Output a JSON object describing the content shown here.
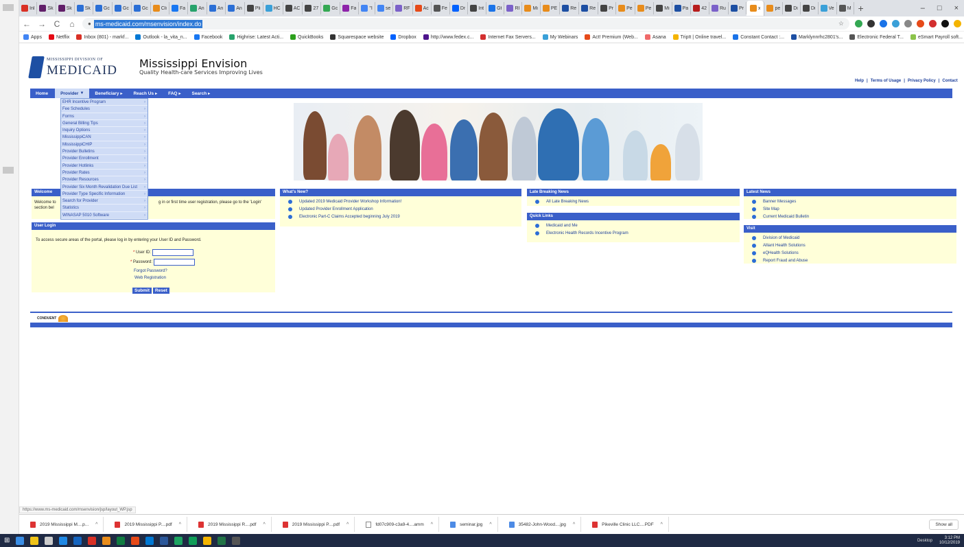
{
  "tabs": [
    {
      "label": "Inl",
      "color": "#d93025"
    },
    {
      "label": "Sk",
      "color": "#611f69"
    },
    {
      "label": "Sk",
      "color": "#611f69"
    },
    {
      "label": "Sk",
      "color": "#2b6fd6"
    },
    {
      "label": "Gc",
      "color": "#2b6fd6"
    },
    {
      "label": "Gc",
      "color": "#2b6fd6"
    },
    {
      "label": "Gc",
      "color": "#2b6fd6"
    },
    {
      "label": "Cli",
      "color": "#e88c1b"
    },
    {
      "label": "Fa",
      "color": "#1877f2"
    },
    {
      "label": "An",
      "color": "#27a36c"
    },
    {
      "label": "An",
      "color": "#2b6fd6"
    },
    {
      "label": "An",
      "color": "#2b6fd6"
    },
    {
      "label": "Pli",
      "color": "#444444"
    },
    {
      "label": "HC",
      "color": "#3aa0d8"
    },
    {
      "label": "AC",
      "color": "#444444"
    },
    {
      "label": "27",
      "color": "#444444"
    },
    {
      "label": "Gc",
      "color": "#34a853"
    },
    {
      "label": "Fa",
      "color": "#8e24aa"
    },
    {
      "label": "\"I",
      "color": "#4285f4"
    },
    {
      "label": "se",
      "color": "#4285f4"
    },
    {
      "label": "RF",
      "color": "#7b61c9"
    },
    {
      "label": "Ac",
      "color": "#e64a19"
    },
    {
      "label": "Fe",
      "color": "#555555"
    },
    {
      "label": "Dr",
      "color": "#0061fe"
    },
    {
      "label": "Int",
      "color": "#444444"
    },
    {
      "label": "Gt",
      "color": "#1a73e8"
    },
    {
      "label": "RI",
      "color": "#7b61c9"
    },
    {
      "label": "Mi",
      "color": "#e88c1b"
    },
    {
      "label": "PE",
      "color": "#e88c1b"
    },
    {
      "label": "Re",
      "color": "#1d4fa3"
    },
    {
      "label": "Re",
      "color": "#1d4fa3"
    },
    {
      "label": "Pr",
      "color": "#444444"
    },
    {
      "label": "Pe",
      "color": "#e88c1b"
    },
    {
      "label": "Pe",
      "color": "#e88c1b"
    },
    {
      "label": "Mi",
      "color": "#444444"
    },
    {
      "label": "Pa",
      "color": "#1d4fa3"
    },
    {
      "label": "42",
      "color": "#b71c1c"
    },
    {
      "label": "Ru",
      "color": "#7b61c9"
    },
    {
      "label": "Pr",
      "color": "#1d4fa3"
    }
  ],
  "active_tab": {
    "label": "x",
    "color": "#e88c1b"
  },
  "tabs_after": [
    {
      "label": "pe",
      "color": "#e88c1b"
    },
    {
      "label": "Di",
      "color": "#444444"
    },
    {
      "label": "Di",
      "color": "#444444"
    },
    {
      "label": "Ve",
      "color": "#3aa0d8"
    },
    {
      "label": "M",
      "color": "#555555"
    }
  ],
  "window_controls": {
    "min": "–",
    "max": "□",
    "close": "×"
  },
  "toolbar": {
    "back": "←",
    "forward": "→",
    "reload": "C",
    "home": "⌂",
    "url": "ms-medicaid.com/msenvision/index.do"
  },
  "bookmarks": [
    {
      "label": "Apps",
      "color": "#4285f4"
    },
    {
      "label": "Netflix",
      "color": "#e50914"
    },
    {
      "label": "Inbox (801) - markf...",
      "color": "#d93025"
    },
    {
      "label": "Outlook - la_vita_n...",
      "color": "#0078d4"
    },
    {
      "label": "Facebook",
      "color": "#1877f2"
    },
    {
      "label": "Highrise: Latest Acti...",
      "color": "#27a36c"
    },
    {
      "label": "QuickBooks",
      "color": "#2ca01c"
    },
    {
      "label": "Squarespace website",
      "color": "#333333"
    },
    {
      "label": "Dropbox",
      "color": "#0061fe"
    },
    {
      "label": "http://www.fedex.c...",
      "color": "#4d148c"
    },
    {
      "label": "Internet Fax Servers...",
      "color": "#d32f2f"
    },
    {
      "label": "My Webinars",
      "color": "#3aa0d8"
    },
    {
      "label": "Act! Premium (Web...",
      "color": "#e64a19"
    },
    {
      "label": "Asana",
      "color": "#f06a6a"
    },
    {
      "label": "TripIt | Online travel...",
      "color": "#f4b400"
    },
    {
      "label": "Constant Contact :...",
      "color": "#1a73e8"
    },
    {
      "label": "Marklynnrhc2801's...",
      "color": "#1d4fa3"
    },
    {
      "label": "Electronic Federal T...",
      "color": "#555555"
    },
    {
      "label": "eSmart Payroll soft...",
      "color": "#8bc34a"
    }
  ],
  "site": {
    "logo_small": "MISSISSIPPI DIVISION OF",
    "logo_big": "MEDICAID",
    "title": "Mississippi Envision",
    "subtitle": "Quality Health-care Services Improving Lives",
    "toplinks": [
      "Help",
      "|",
      "Terms of Usage",
      "|",
      "Privacy Policy",
      "|",
      "Contact"
    ]
  },
  "nav": [
    {
      "label": "Home",
      "arrow": ""
    },
    {
      "label": "Provider",
      "arrow": "▼"
    },
    {
      "label": "Beneficiary",
      "arrow": "▸"
    },
    {
      "label": "Reach Us",
      "arrow": "▸"
    },
    {
      "label": "FAQ",
      "arrow": "▸"
    },
    {
      "label": "Search",
      "arrow": "▸"
    }
  ],
  "provider_menu": [
    "EHR Incentive Program",
    "Fee Schedules",
    "Forms",
    "General Billing Tips",
    "Inquiry Options",
    "MississippiCAN",
    "MississippiCHIP",
    "Provider Bulletins",
    "Provider Enrollment",
    "Provider Hotlinks",
    "Provider Rates",
    "Provider Resources",
    "Provider Six Month Revalidation Due List",
    "Provider Type Specific Information",
    "Search for Provider",
    "Statistics",
    "WINASAP 5010 Software"
  ],
  "welcome": {
    "heading": "Welcome",
    "text_left": "Welcome to",
    "text_right": "g in or first time user registration, please go to the 'Login'",
    "text_left2": "section bel"
  },
  "login": {
    "heading": "User Login",
    "instructions": "To access secure areas of the portal, please log in by entering your User ID and Password.",
    "user_label": "User ID:",
    "password_label": "Password:",
    "required_mark": "*",
    "forgot": "Forgot Password?",
    "register": "Web Registration",
    "submit": "Submit",
    "reset": "Reset"
  },
  "whats_new": {
    "heading": "What's New?",
    "items": [
      "Updated 2019 Medicaid Provider Workshop Information!",
      "Updated Provider Enrollment Application",
      "Electronic Part-C Claims Accepted beginning July 2019"
    ]
  },
  "late_breaking": {
    "heading": "Late Breaking News",
    "items": [
      "All Late Breaking News"
    ]
  },
  "quick_links": {
    "heading": "Quick Links",
    "items": [
      "Medicaid and Me",
      "Electronic Health Records Incentive Program"
    ]
  },
  "latest_news": {
    "heading": "Latest News",
    "items": [
      "Banner Messages",
      "Site Map",
      "Current Medicaid Bulletin"
    ]
  },
  "visit": {
    "heading": "Visit",
    "items": [
      "Division of Medicaid",
      "Alliant Health Solutions",
      "eQHealth Solutions",
      "Report Fraud and Abuse"
    ]
  },
  "footer": {
    "logo_text": "CONDUENT"
  },
  "status_url": "https://www.ms-medicaid.com/msenvision/jsp/layout_WP.jsp",
  "downloads": [
    {
      "name": "2019 Mississippi M....p...",
      "type": "pdf"
    },
    {
      "name": "2019 Mississippi P....pdf",
      "type": "pdf"
    },
    {
      "name": "2019 Mississippi R....pdf",
      "type": "pdf"
    },
    {
      "name": "2019 Mississippi P....pdf",
      "type": "pdf"
    },
    {
      "name": "fd07c909-c3a9-4....amm",
      "type": "file"
    },
    {
      "name": "seminar.jpg",
      "type": "img"
    },
    {
      "name": "35482-John-Wood....jpg",
      "type": "img"
    },
    {
      "name": "Pikeville Clinic LLC....PDF",
      "type": "pdf"
    }
  ],
  "downloads_chevron": "^",
  "show_all": "Show all",
  "taskbar": {
    "apps": [
      "#3a8ee6",
      "#f0c419",
      "#cccccc",
      "#1e88e5",
      "#1565c0",
      "#d93025",
      "#e88c1b",
      "#107c41",
      "#e64a19",
      "#0078d4",
      "#2b579a",
      "#1da462",
      "#0f9d58",
      "#f4b400",
      "#217346",
      "#555555"
    ],
    "desktop": "Desktop",
    "time": "3:12 PM",
    "date": "10/12/2019"
  }
}
